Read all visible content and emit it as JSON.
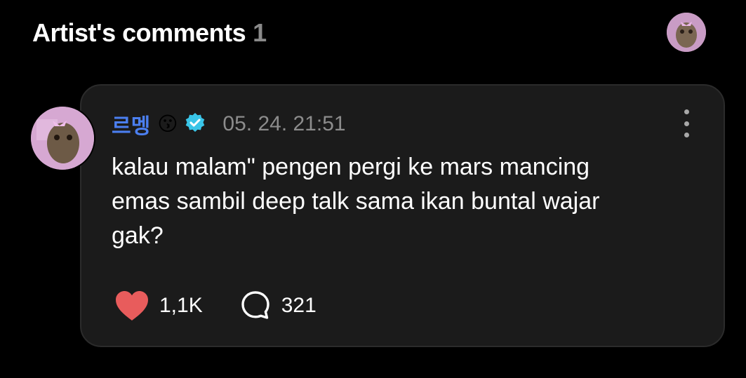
{
  "header": {
    "title": "Artist's comments",
    "count": "1"
  },
  "comment": {
    "author": "르멩",
    "author_emoji": "😗",
    "verified": true,
    "timestamp": "05. 24. 21:51",
    "text": "kalau malam\"  pengen pergi ke mars mancing\nemas sambil deep talk sama ikan buntal wajar\ngak?",
    "likes": "1,1K",
    "replies": "321"
  },
  "colors": {
    "background": "#000000",
    "card": "#1b1b1b",
    "author_name": "#4b7ff0",
    "verified_badge": "#39c5e8",
    "like_heart": "#e85c5c"
  },
  "icons": {
    "verified": "verified-badge-icon",
    "like": "heart-icon",
    "reply": "speech-bubble-icon",
    "more": "more-vertical-icon"
  }
}
